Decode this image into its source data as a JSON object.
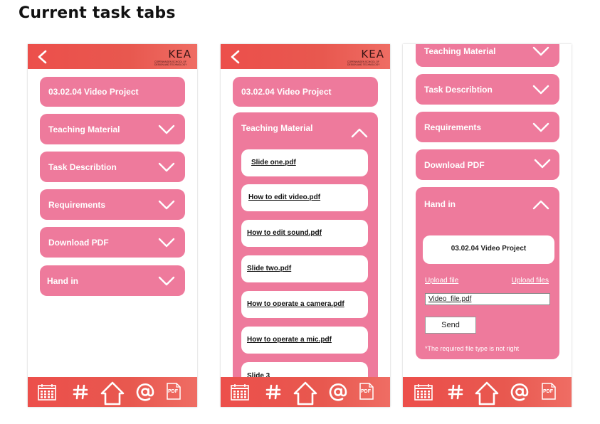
{
  "page_title": "Current task tabs",
  "colors": {
    "header": "#e8584f",
    "tile": "#ee7a9c",
    "white": "#ffffff"
  },
  "logo": {
    "wordmark": "KEA",
    "tagline": "COPENHAGEN SCHOOL OF DESIGN AND TECHNOLOGY"
  },
  "nav_icons": [
    "calendar-icon",
    "hashtag-icon",
    "home-icon",
    "at-icon",
    "pdf-icon"
  ],
  "nav_pdf_label": "PDF",
  "screen1": {
    "project_title": "03.02.04 Video Project",
    "tabs": [
      "Teaching Material",
      "Task Describtion",
      "Requirements",
      "Download PDF",
      "Hand in"
    ]
  },
  "screen2": {
    "project_title": "03.02.04 Video Project",
    "open_tab": "Teaching Material",
    "files": [
      "Slide one.pdf",
      "How to edit video.pdf",
      "How to edit sound.pdf",
      "Slide two.pdf",
      "How to operate a camera.pdf",
      "How to operate a mic.pdf",
      "Slide 3"
    ]
  },
  "screen3": {
    "tabs": [
      "Teaching Material",
      "Task Describtion",
      "Requirements",
      "Download PDF"
    ],
    "open_tab": "Hand in",
    "project_title": "03.02.04 Video Project",
    "upload_file": "Upload file",
    "upload_files": "Upload files",
    "file_value": "Video_file.pdf",
    "send_label": "Send",
    "note": "*The required file type is not right"
  }
}
